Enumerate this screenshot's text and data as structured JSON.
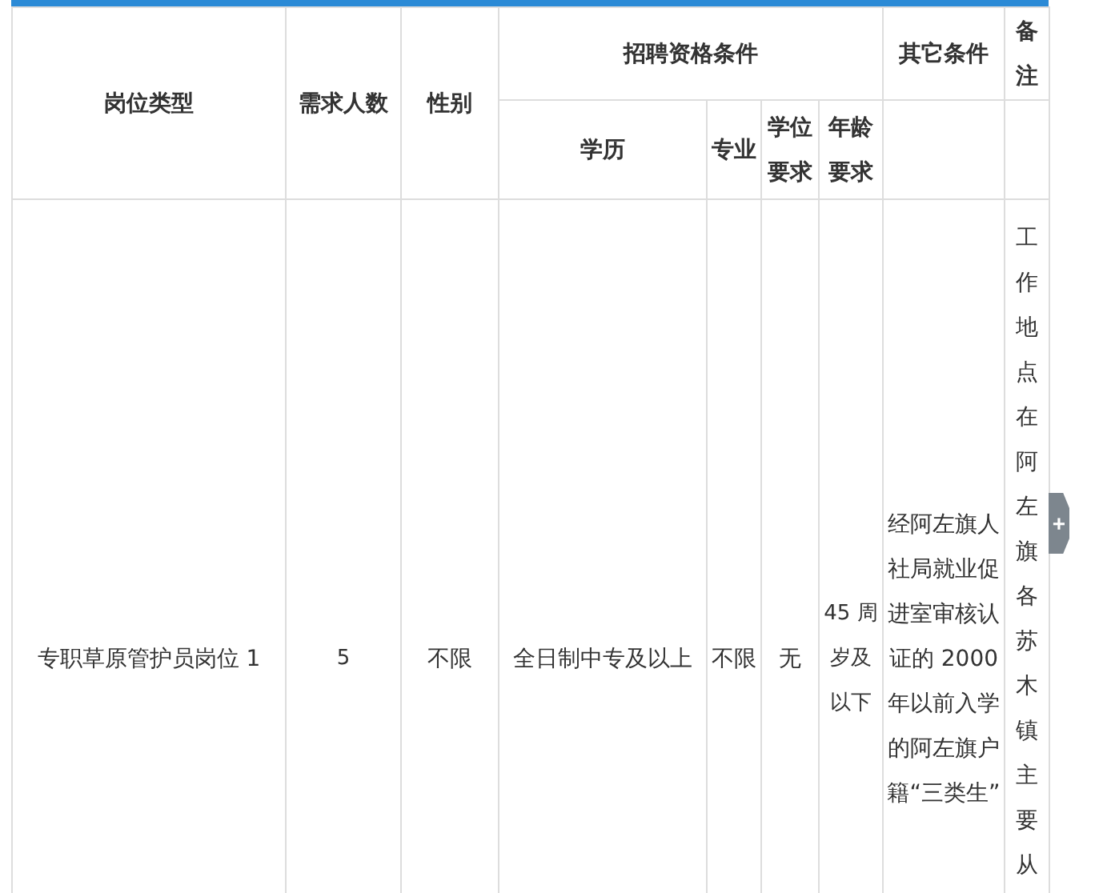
{
  "table": {
    "header_groups": [
      {
        "label": "岗位类型",
        "rowspan": 2
      },
      {
        "label": "需求人数",
        "rowspan": 2
      },
      {
        "label": "性别",
        "rowspan": 2
      },
      {
        "label": "招聘资格条件",
        "colspan": 4
      },
      {
        "label": "其它条件"
      },
      {
        "label": "备注"
      }
    ],
    "sub_headers": [
      "学历",
      "专业",
      "学位要求",
      "年龄要求"
    ],
    "rows": [
      {
        "cells": [
          "专职草原管护员岗位 1",
          "5",
          "不限",
          "全日制中专及以上",
          "不限",
          "无",
          "45 周岁及以下",
          "经阿左旗人社局就业促进室审核认证的 2000 年以前入学的阿左旗户籍“三类生”",
          "工作地点在阿左旗各苏木镇主要从"
        ]
      }
    ]
  },
  "side_tab": {
    "label": "+"
  }
}
